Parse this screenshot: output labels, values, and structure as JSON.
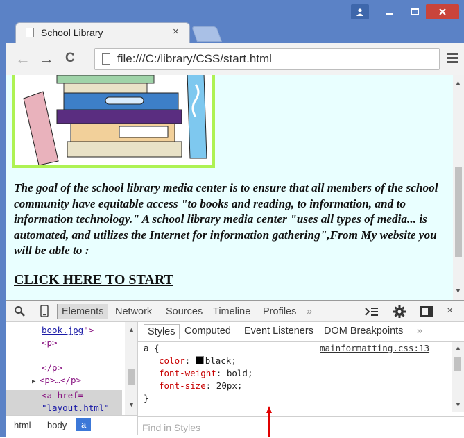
{
  "window": {
    "title_icons": {
      "user": "user-icon",
      "minimize": "minimize-icon",
      "maximize": "maximize-icon",
      "close": "close-icon"
    }
  },
  "tab": {
    "title": "School Library",
    "close": "×"
  },
  "toolbar": {
    "back": "←",
    "forward": "→",
    "reload": "C",
    "url": "file:///C:/library/CSS/start.html"
  },
  "page": {
    "paragraph": "The goal of the school library media center is to ensure that all members of the school community have equitable access \"to books and reading, to information, and to information technology.\" A school library media center \"uses all types of media... is automated, and utilizes the Internet for information gathering\",From My website you will be able to :",
    "link": "CLICK HERE TO START"
  },
  "devtools": {
    "tabs": [
      "Elements",
      "Network",
      "Sources",
      "Timeline",
      "Profiles"
    ],
    "more": "»",
    "dom": {
      "line1_val": "book.jpg",
      "line1_end": "\">",
      "line2": "<p>",
      "line3": "</p>",
      "line4": "<p>…</p>",
      "line5_tag": "<a href=",
      "line6_val": "\"layout.html\""
    },
    "breadcrumbs": [
      "html",
      "body",
      "a"
    ],
    "styles_tabs": [
      "Styles",
      "Computed",
      "Event Listeners",
      "DOM Breakpoints"
    ],
    "styles_more": "»",
    "rule": {
      "selector": "a {",
      "source": "mainformatting.css:13",
      "props": [
        {
          "name": "color",
          "value": "black;"
        },
        {
          "name": "font-weight",
          "value": "bold;"
        },
        {
          "name": "font-size",
          "value": "20px;"
        }
      ],
      "close": "}"
    },
    "find_placeholder": "Find in Styles"
  },
  "colors": {
    "frame": "#5b82c6",
    "page_bg": "#e9ffff",
    "image_border": "#aef253",
    "close_button": "#c9443b",
    "arrow": "#e00000"
  }
}
